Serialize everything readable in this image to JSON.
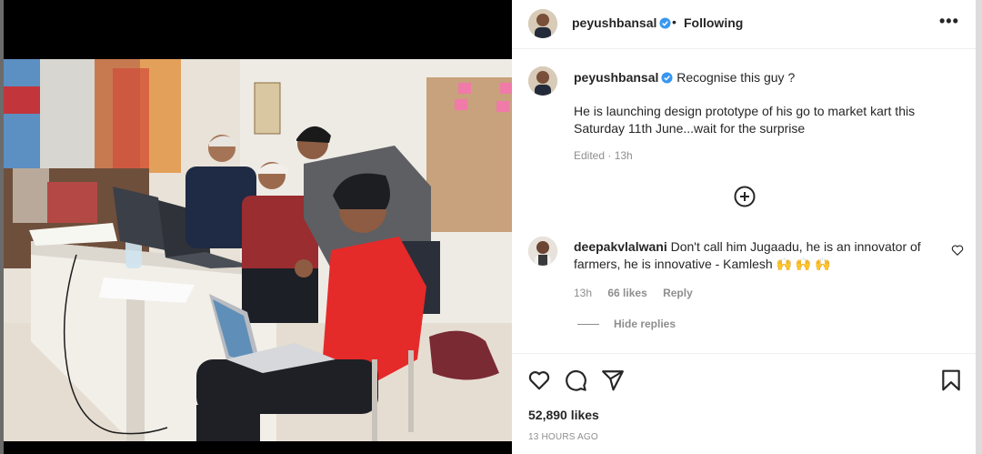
{
  "header": {
    "username": "peyushbansal",
    "separator": "•",
    "follow_status": "Following",
    "more_label": "•••"
  },
  "caption": {
    "username": "peyushbansal",
    "headline": "Recognise this guy ?",
    "body": "He is launching design prototype of his go to market kart this Saturday 11th June...wait for the surprise",
    "edited": "Edited · 13h"
  },
  "comment": {
    "username": "deepakvlalwani",
    "text": "Don't call him Jugaadu, he is an innovator of farmers, he is innovative - Kamlesh 🙌 🙌 🙌",
    "age": "13h",
    "likes": "66 likes",
    "reply_label": "Reply"
  },
  "replies": {
    "label": "Hide replies"
  },
  "footer": {
    "likes": "52,890 likes",
    "timestamp": "13 HOURS AGO"
  },
  "icons": {
    "verified": "verified-badge-icon",
    "more": "more-options-icon",
    "load_more": "plus-circle-icon",
    "comment_like": "heart-icon",
    "like": "heart-icon",
    "comment": "comment-icon",
    "share": "share-icon",
    "save": "bookmark-icon"
  },
  "colors": {
    "verified": "#3897f0",
    "secondary_text": "#8e8e8e",
    "primary_text": "#262626"
  }
}
